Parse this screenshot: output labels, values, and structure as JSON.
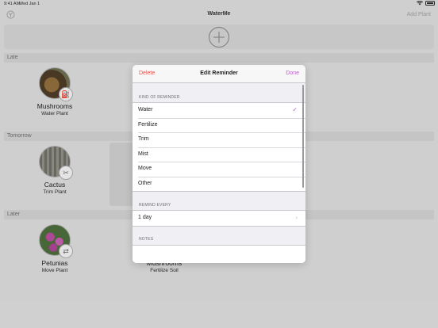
{
  "status_bar": {
    "time": "9:41 AM",
    "date": "Wed Jan 1"
  },
  "nav": {
    "title": "WaterMe",
    "add_plant_label": "Add Plant"
  },
  "sections": {
    "late": "Late",
    "tomorrow": "Tomorrow",
    "later": "Later"
  },
  "plants": [
    {
      "name": "Mushrooms",
      "task": "Water Plant",
      "badge_icon": "watering-can-icon"
    },
    {
      "name": "Cactus",
      "task": "Trim Plant",
      "badge_icon": "scissors-icon"
    },
    {
      "name": "Petunias",
      "task": "Move Plant",
      "badge_icon": "move-icon"
    },
    {
      "name": "Mushrooms",
      "task": "Fertilize Soil",
      "badge_icon": "fertilize-icon"
    }
  ],
  "modal": {
    "delete_label": "Delete",
    "title": "Edit Reminder",
    "done_label": "Done",
    "kind_header": "KIND OF REMINDER",
    "kinds": [
      "Water",
      "Fertilize",
      "Trim",
      "Mist",
      "Move",
      "Other"
    ],
    "selected_kind": "Water",
    "remind_header": "REMIND EVERY",
    "interval": "1 day",
    "notes_header": "NOTES"
  },
  "colors": {
    "accent": "#b764c9",
    "destructive": "#e8524a",
    "background": "#d4d4d4"
  }
}
